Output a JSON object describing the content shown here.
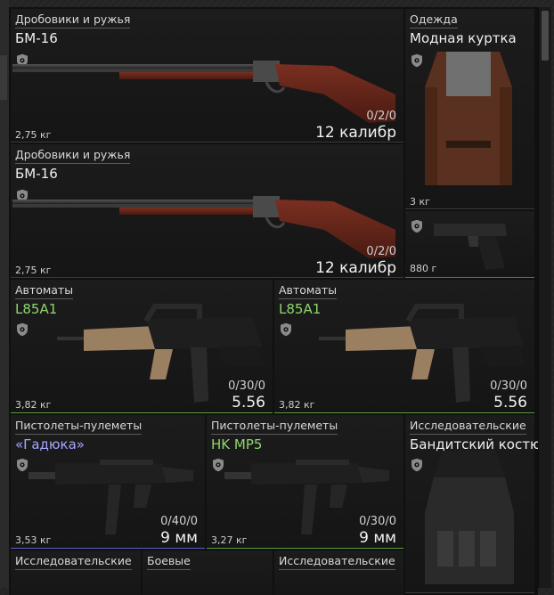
{
  "inventory": {
    "items": [
      {
        "category": "Дробовики и ружья",
        "name": "БМ-16",
        "weight": "2,75 кг",
        "ammo": "0/2/0",
        "caliber": "12 калибр"
      },
      {
        "category": "Дробовики и ружья",
        "name": "БМ-16",
        "weight": "2,75 кг",
        "ammo": "0/2/0",
        "caliber": "12 калибр"
      },
      {
        "category": "Одежда",
        "name": "Модная куртка",
        "weight": "3 кг"
      },
      {
        "weight": "880 г"
      },
      {
        "category": "Автоматы",
        "name": "L85A1",
        "weight": "3,82 кг",
        "ammo": "0/30/0",
        "caliber": "5.56"
      },
      {
        "category": "Автоматы",
        "name": "L85A1",
        "weight": "3,82 кг",
        "ammo": "0/30/0",
        "caliber": "5.56"
      },
      {
        "category": "Пистолеты-пулеметы",
        "name": "«Гадюка»",
        "weight": "3,53 кг",
        "ammo": "0/40/0",
        "caliber": "9 мм"
      },
      {
        "category": "Пистолеты-пулеметы",
        "name": "HK MP5",
        "weight": "3,27 кг",
        "ammo": "0/30/0",
        "caliber": "9 мм"
      },
      {
        "category": "Исследовательские",
        "name": "Бандитский костюм"
      },
      {
        "category": "Исследовательские"
      },
      {
        "category": "Боевые"
      },
      {
        "category": "Исследовательские"
      }
    ]
  },
  "colors": {
    "rarity_green": "#8fd66b",
    "rarity_purple": "#a4a6ff",
    "border_green": "#5aa03c",
    "border_purple": "#5a5fc0"
  },
  "icons": {
    "protection": "shield-icon",
    "scroll": "scrollbar-thumb"
  }
}
